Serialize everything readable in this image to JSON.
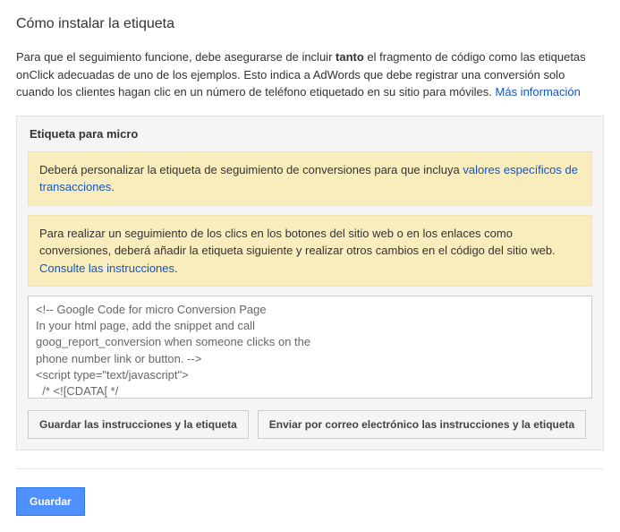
{
  "heading": "Cómo instalar la etiqueta",
  "intro": {
    "part1": "Para que el seguimiento funcione, debe asegurarse de incluir ",
    "bold": "tanto",
    "part2": " el fragmento de código como las etiquetas onClick adecuadas de uno de los ejemplos. Esto indica a AdWords que debe registrar una conversión solo cuando los clientes hagan clic en un número de teléfono etiquetado en su sitio para móviles. ",
    "link": "Más información"
  },
  "panel": {
    "title": "Etiqueta para micro",
    "notice1": {
      "text": "Deberá personalizar la etiqueta de seguimiento de conversiones para que incluya ",
      "link": "valores específicos de transacciones",
      "tail": "."
    },
    "notice2": {
      "text": "Para realizar un seguimiento de los clics en los botones del sitio web o en los enlaces como conversiones, deberá añadir la etiqueta siguiente y realizar otros cambios en el código del sitio web. ",
      "link": "Consulte las instrucciones",
      "tail": "."
    },
    "code": "<!-- Google Code for micro Conversion Page\nIn your html page, add the snippet and call\ngoog_report_conversion when someone clicks on the\nphone number link or button. -->\n<script type=\"text/javascript\">\n  /* <![CDATA[ */\n  goog_snippet_vars = function() {\n    var w = window;",
    "buttons": {
      "save_instructions": "Guardar las instrucciones y la etiqueta",
      "email_instructions": "Enviar por correo electrónico las instrucciones y la etiqueta"
    }
  },
  "footer": {
    "save": "Guardar"
  }
}
